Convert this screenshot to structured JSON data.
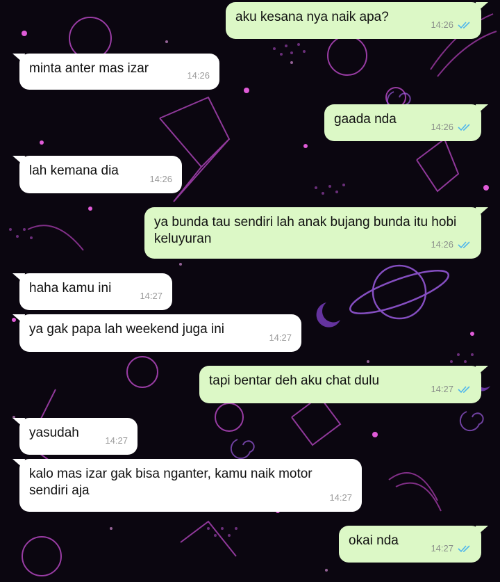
{
  "chat": {
    "messages": [
      {
        "direction": "out",
        "text": "aku kesana nya naik apa?",
        "time": "14:26",
        "status": "read"
      },
      {
        "direction": "in",
        "text": "minta anter mas izar",
        "time": "14:26"
      },
      {
        "direction": "out",
        "text": "gaada nda",
        "time": "14:26",
        "status": "read"
      },
      {
        "direction": "in",
        "text": "lah kemana dia",
        "time": "14:26"
      },
      {
        "direction": "out",
        "text": "ya bunda tau sendiri lah anak bujang bunda itu hobi keluyuran",
        "time": "14:26",
        "status": "read"
      },
      {
        "direction": "in",
        "text": "haha kamu ini",
        "time": "14:27"
      },
      {
        "direction": "in",
        "text": "ya gak papa lah weekend juga ini",
        "time": "14:27"
      },
      {
        "direction": "out",
        "text": "tapi bentar deh aku chat dulu",
        "time": "14:27",
        "status": "read"
      },
      {
        "direction": "in",
        "text": "yasudah",
        "time": "14:27"
      },
      {
        "direction": "in",
        "text": "kalo mas izar gak bisa nganter, kamu naik motor sendiri aja",
        "time": "14:27"
      },
      {
        "direction": "out",
        "text": "okai nda",
        "time": "14:27",
        "status": "read"
      }
    ]
  },
  "colors": {
    "incoming_bubble": "#ffffff",
    "outgoing_bubble": "#dcf8c6",
    "read_tick": "#4fb6ec",
    "wallpaper": "#0b0610",
    "doodle_pink": "#d14bd8",
    "doodle_purple": "#8f4bd1"
  },
  "wallpaper": {
    "icon": "space-doodle-wallpaper"
  }
}
